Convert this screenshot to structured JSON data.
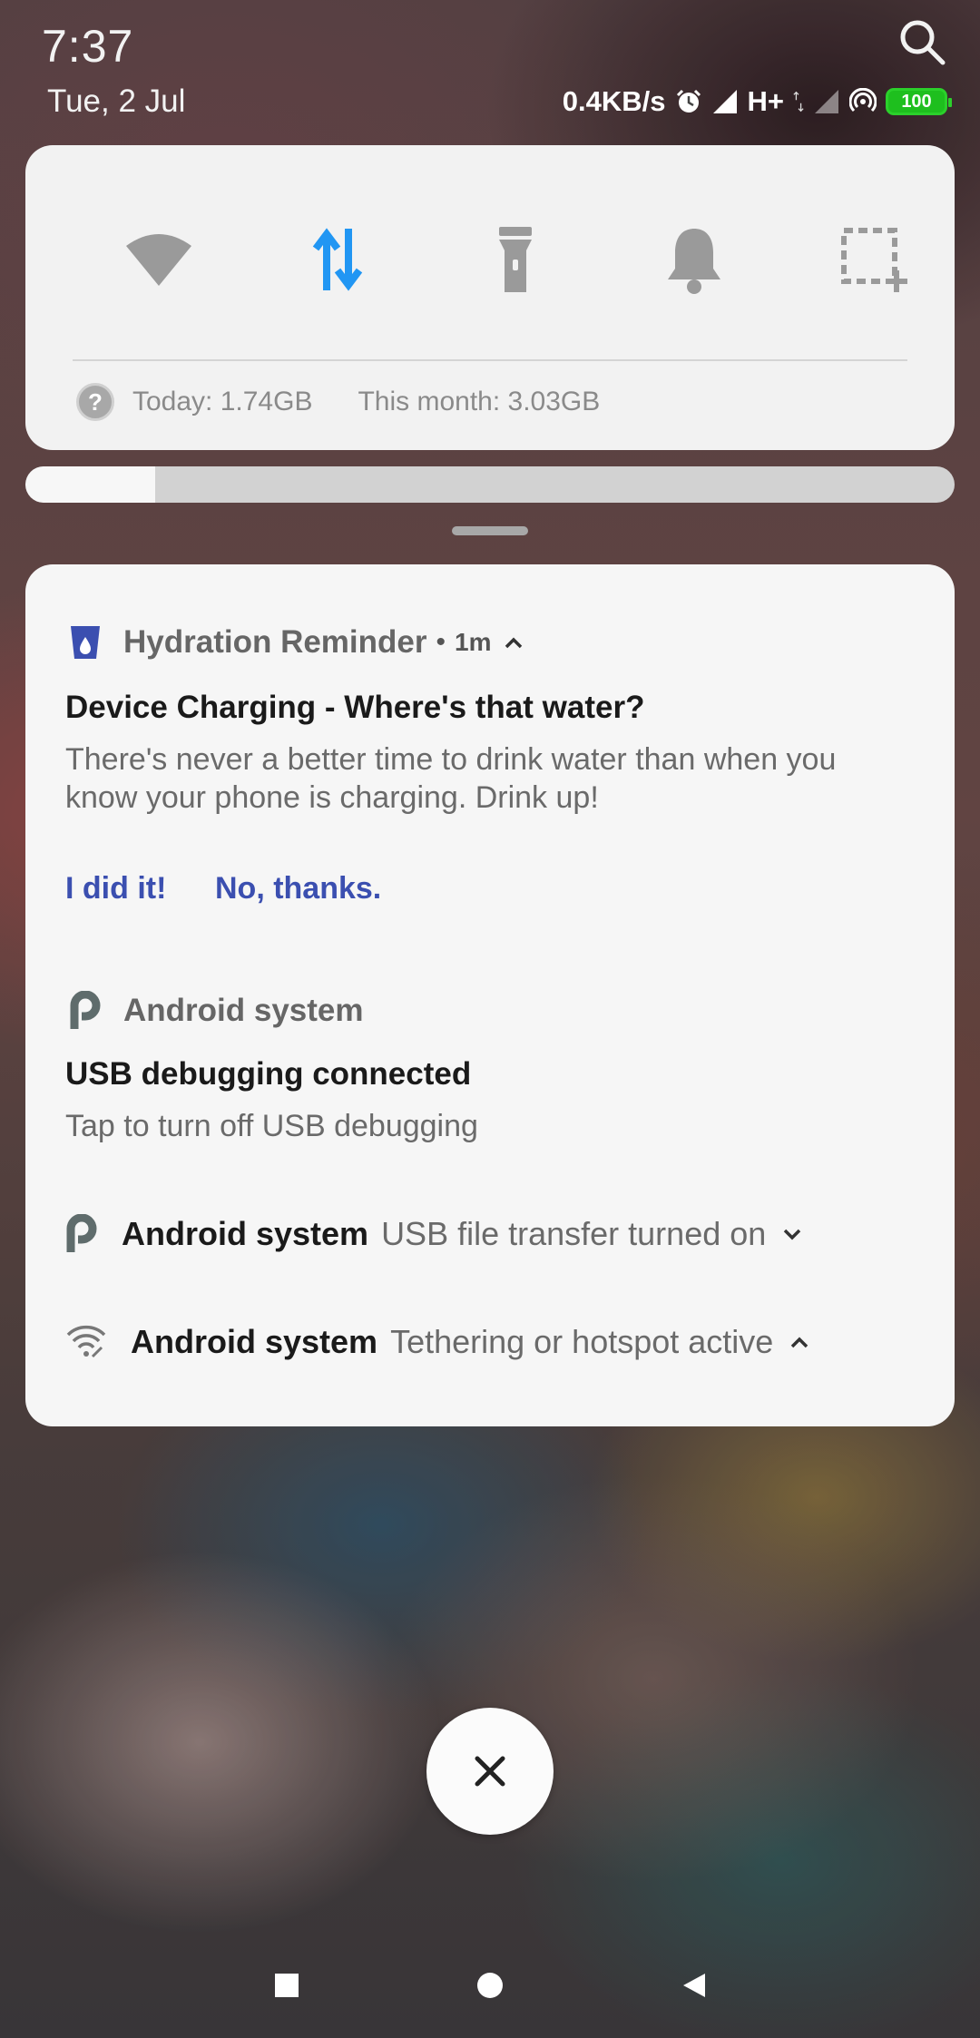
{
  "status_bar": {
    "time": "7:37",
    "date": "Tue, 2 Jul",
    "network_speed": "0.4KB/s",
    "network_type": "H+",
    "battery": "100",
    "icons": [
      "alarm-icon",
      "signal-icon",
      "signal-empty-icon",
      "hotspot-icon",
      "battery-icon",
      "search-icon"
    ]
  },
  "quick_settings": {
    "toggles": [
      {
        "name": "wifi",
        "icon": "wifi-icon",
        "active": false
      },
      {
        "name": "mobile-data",
        "icon": "mobile-data-icon",
        "active": true
      },
      {
        "name": "flashlight",
        "icon": "flashlight-icon",
        "active": false
      },
      {
        "name": "sound",
        "icon": "bell-icon",
        "active": false
      },
      {
        "name": "screenshot",
        "icon": "screenshot-icon",
        "active": false
      }
    ],
    "usage_today": "Today: 1.74GB",
    "usage_month": "This month: 3.03GB",
    "brightness_level": 0.14,
    "accent_color": "#2196F3"
  },
  "notifications": [
    {
      "app": "Hydration Reminder",
      "separator": "•",
      "age": "1m",
      "title": "Device Charging - Where's that water?",
      "text": "There's never a better time to drink water than when you know your phone is charging. Drink up!",
      "actions": [
        "I did it!",
        "No, thanks."
      ],
      "icon": "water-glass-icon"
    },
    {
      "app": "Android system",
      "title": "USB debugging connected",
      "text": "Tap to turn off USB debugging",
      "icon": "android-p-icon"
    },
    {
      "app": "Android system",
      "text": "USB file transfer turned on",
      "icon": "android-p-icon"
    },
    {
      "app": "Android system",
      "text": "Tethering or hotspot active",
      "icon": "hotspot-link-icon"
    }
  ],
  "colors": {
    "action_blue": "#3B4FB0",
    "battery_green": "#1EBF1E"
  },
  "nav_bar": {
    "icons": [
      "recents-square-icon",
      "home-circle-icon",
      "back-triangle-icon"
    ]
  }
}
